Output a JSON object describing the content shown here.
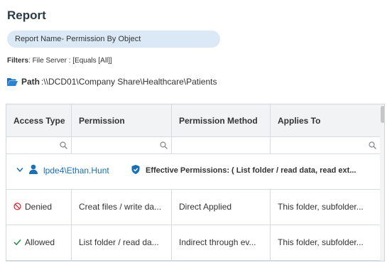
{
  "title": "Report",
  "report_name": "Report Name- Permission By Object",
  "filters": {
    "label": "Filters",
    "text": ": File Server : [Equals [All]]"
  },
  "path": {
    "label": "Path",
    "value": ":\\\\DCD01\\Company Share\\Healthcare\\Patients"
  },
  "table": {
    "columns": [
      "Access Type",
      "Permission",
      "Permission Method",
      "Applies To"
    ],
    "group": {
      "user": "lpde4\\Ethan.Hunt",
      "summary": "Effective Permissions: ( List folder / read data, read ext..."
    },
    "rows": [
      {
        "access": "Denied",
        "permission": "Creat files / write da...",
        "method": "Direct Applied",
        "applies": "This folder, subfolder..."
      },
      {
        "access": "Allowed",
        "permission": "List folder / read da...",
        "method": "Indirect through ev...",
        "applies": "This folder, subfolder..."
      }
    ]
  },
  "colors": {
    "denied": "#d0262d",
    "allowed": "#1f8a3c",
    "link": "#1a6fb5",
    "accent": "#1a6fb5"
  }
}
